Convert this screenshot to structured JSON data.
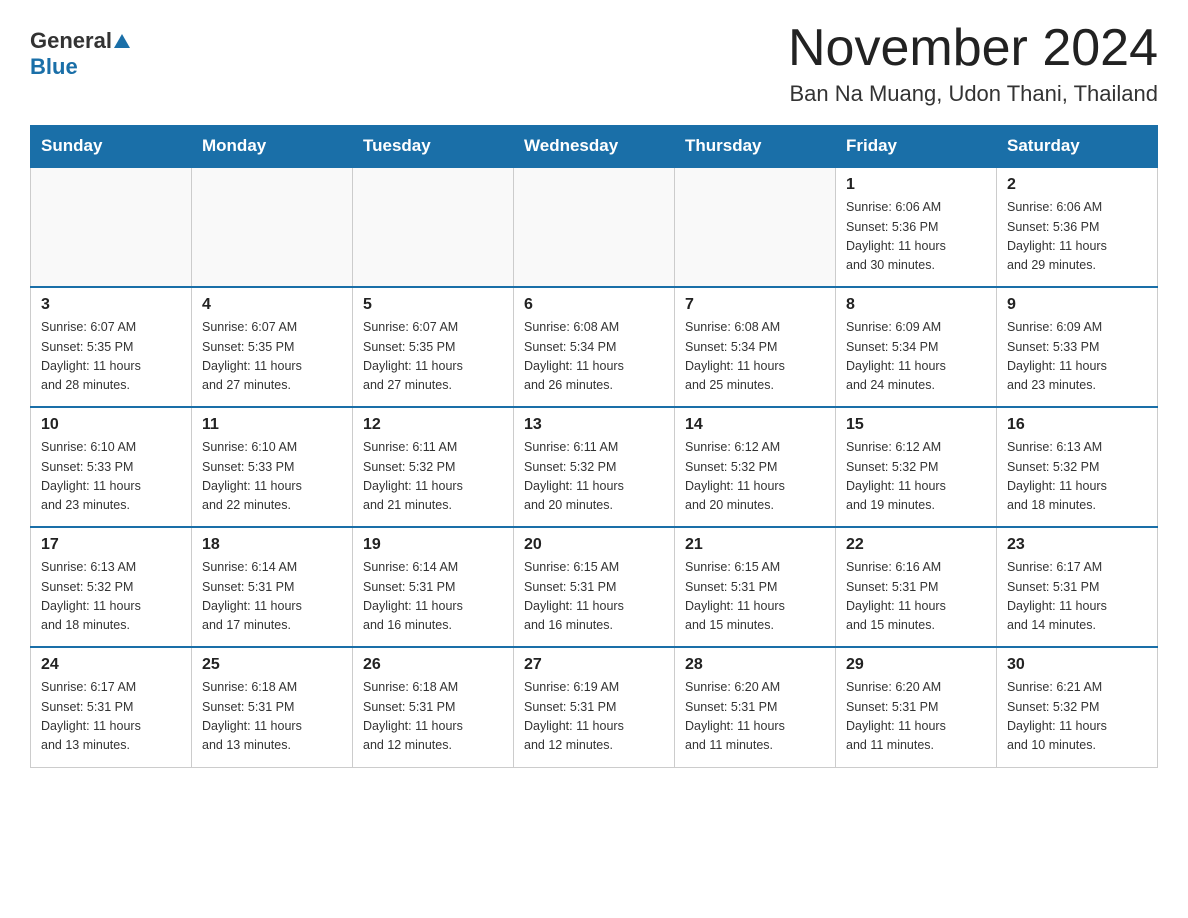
{
  "header": {
    "logo_general": "General",
    "logo_blue": "Blue",
    "month_title": "November 2024",
    "location": "Ban Na Muang, Udon Thani, Thailand"
  },
  "days_of_week": [
    "Sunday",
    "Monday",
    "Tuesday",
    "Wednesday",
    "Thursday",
    "Friday",
    "Saturday"
  ],
  "weeks": [
    [
      {
        "day": "",
        "info": ""
      },
      {
        "day": "",
        "info": ""
      },
      {
        "day": "",
        "info": ""
      },
      {
        "day": "",
        "info": ""
      },
      {
        "day": "",
        "info": ""
      },
      {
        "day": "1",
        "info": "Sunrise: 6:06 AM\nSunset: 5:36 PM\nDaylight: 11 hours\nand 30 minutes."
      },
      {
        "day": "2",
        "info": "Sunrise: 6:06 AM\nSunset: 5:36 PM\nDaylight: 11 hours\nand 29 minutes."
      }
    ],
    [
      {
        "day": "3",
        "info": "Sunrise: 6:07 AM\nSunset: 5:35 PM\nDaylight: 11 hours\nand 28 minutes."
      },
      {
        "day": "4",
        "info": "Sunrise: 6:07 AM\nSunset: 5:35 PM\nDaylight: 11 hours\nand 27 minutes."
      },
      {
        "day": "5",
        "info": "Sunrise: 6:07 AM\nSunset: 5:35 PM\nDaylight: 11 hours\nand 27 minutes."
      },
      {
        "day": "6",
        "info": "Sunrise: 6:08 AM\nSunset: 5:34 PM\nDaylight: 11 hours\nand 26 minutes."
      },
      {
        "day": "7",
        "info": "Sunrise: 6:08 AM\nSunset: 5:34 PM\nDaylight: 11 hours\nand 25 minutes."
      },
      {
        "day": "8",
        "info": "Sunrise: 6:09 AM\nSunset: 5:34 PM\nDaylight: 11 hours\nand 24 minutes."
      },
      {
        "day": "9",
        "info": "Sunrise: 6:09 AM\nSunset: 5:33 PM\nDaylight: 11 hours\nand 23 minutes."
      }
    ],
    [
      {
        "day": "10",
        "info": "Sunrise: 6:10 AM\nSunset: 5:33 PM\nDaylight: 11 hours\nand 23 minutes."
      },
      {
        "day": "11",
        "info": "Sunrise: 6:10 AM\nSunset: 5:33 PM\nDaylight: 11 hours\nand 22 minutes."
      },
      {
        "day": "12",
        "info": "Sunrise: 6:11 AM\nSunset: 5:32 PM\nDaylight: 11 hours\nand 21 minutes."
      },
      {
        "day": "13",
        "info": "Sunrise: 6:11 AM\nSunset: 5:32 PM\nDaylight: 11 hours\nand 20 minutes."
      },
      {
        "day": "14",
        "info": "Sunrise: 6:12 AM\nSunset: 5:32 PM\nDaylight: 11 hours\nand 20 minutes."
      },
      {
        "day": "15",
        "info": "Sunrise: 6:12 AM\nSunset: 5:32 PM\nDaylight: 11 hours\nand 19 minutes."
      },
      {
        "day": "16",
        "info": "Sunrise: 6:13 AM\nSunset: 5:32 PM\nDaylight: 11 hours\nand 18 minutes."
      }
    ],
    [
      {
        "day": "17",
        "info": "Sunrise: 6:13 AM\nSunset: 5:32 PM\nDaylight: 11 hours\nand 18 minutes."
      },
      {
        "day": "18",
        "info": "Sunrise: 6:14 AM\nSunset: 5:31 PM\nDaylight: 11 hours\nand 17 minutes."
      },
      {
        "day": "19",
        "info": "Sunrise: 6:14 AM\nSunset: 5:31 PM\nDaylight: 11 hours\nand 16 minutes."
      },
      {
        "day": "20",
        "info": "Sunrise: 6:15 AM\nSunset: 5:31 PM\nDaylight: 11 hours\nand 16 minutes."
      },
      {
        "day": "21",
        "info": "Sunrise: 6:15 AM\nSunset: 5:31 PM\nDaylight: 11 hours\nand 15 minutes."
      },
      {
        "day": "22",
        "info": "Sunrise: 6:16 AM\nSunset: 5:31 PM\nDaylight: 11 hours\nand 15 minutes."
      },
      {
        "day": "23",
        "info": "Sunrise: 6:17 AM\nSunset: 5:31 PM\nDaylight: 11 hours\nand 14 minutes."
      }
    ],
    [
      {
        "day": "24",
        "info": "Sunrise: 6:17 AM\nSunset: 5:31 PM\nDaylight: 11 hours\nand 13 minutes."
      },
      {
        "day": "25",
        "info": "Sunrise: 6:18 AM\nSunset: 5:31 PM\nDaylight: 11 hours\nand 13 minutes."
      },
      {
        "day": "26",
        "info": "Sunrise: 6:18 AM\nSunset: 5:31 PM\nDaylight: 11 hours\nand 12 minutes."
      },
      {
        "day": "27",
        "info": "Sunrise: 6:19 AM\nSunset: 5:31 PM\nDaylight: 11 hours\nand 12 minutes."
      },
      {
        "day": "28",
        "info": "Sunrise: 6:20 AM\nSunset: 5:31 PM\nDaylight: 11 hours\nand 11 minutes."
      },
      {
        "day": "29",
        "info": "Sunrise: 6:20 AM\nSunset: 5:31 PM\nDaylight: 11 hours\nand 11 minutes."
      },
      {
        "day": "30",
        "info": "Sunrise: 6:21 AM\nSunset: 5:32 PM\nDaylight: 11 hours\nand 10 minutes."
      }
    ]
  ]
}
